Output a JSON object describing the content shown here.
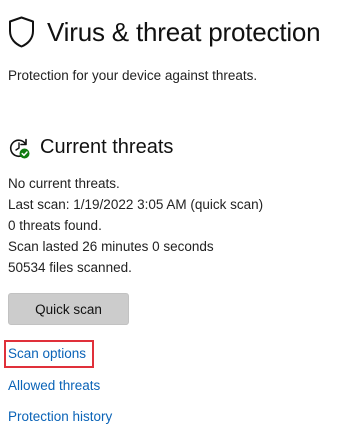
{
  "header": {
    "title": "Virus & threat protection",
    "title_icon": "shield-icon",
    "subtitle": "Protection for your device against threats."
  },
  "current_threats": {
    "heading": "Current threats",
    "heading_icon": "refresh-check-icon",
    "status_lines": [
      "No current threats.",
      "Last scan: 1/19/2022 3:05 AM (quick scan)",
      "0 threats found.",
      "Scan lasted 26 minutes 0 seconds",
      "50534 files scanned."
    ],
    "quick_scan_label": "Quick scan"
  },
  "links": {
    "scan_options": "Scan options",
    "allowed_threats": "Allowed threats",
    "protection_history": "Protection history"
  },
  "colors": {
    "link": "#0a63b7",
    "highlight": "#e0303a",
    "button_bg": "#cccccc",
    "check_badge": "#107c10"
  }
}
